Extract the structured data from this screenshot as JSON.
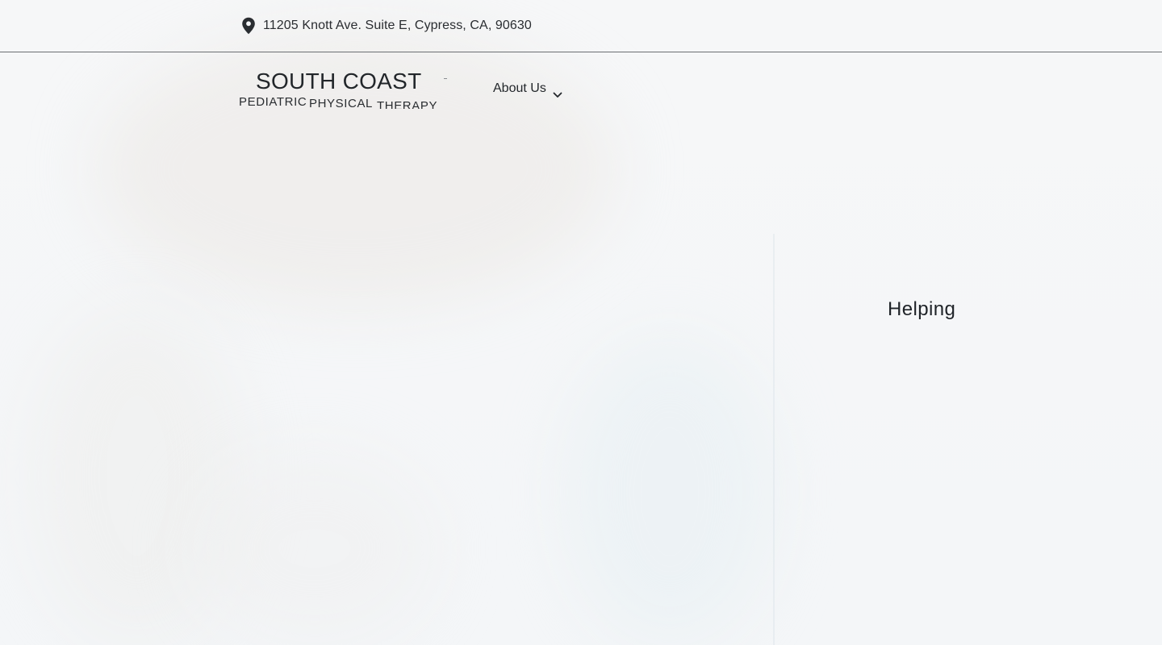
{
  "topbar": {
    "address": "11205 Knott Ave. Suite E, Cypress, CA, 90630",
    "address_icon": "map-pin-icon"
  },
  "header": {
    "logo": {
      "main": "SOUTH COAST",
      "sub_1": "PEDIATRIC",
      "sub_2": "PHYSICAL",
      "sub_3": "THERAPY"
    },
    "nav": {
      "about_label": "About Us",
      "about_icon": "chevron-down-icon"
    }
  },
  "hero": {
    "word": "Helping"
  },
  "colors": {
    "background": "#f4f6f8",
    "text": "#1f2328",
    "divider": "#6b6e72"
  }
}
